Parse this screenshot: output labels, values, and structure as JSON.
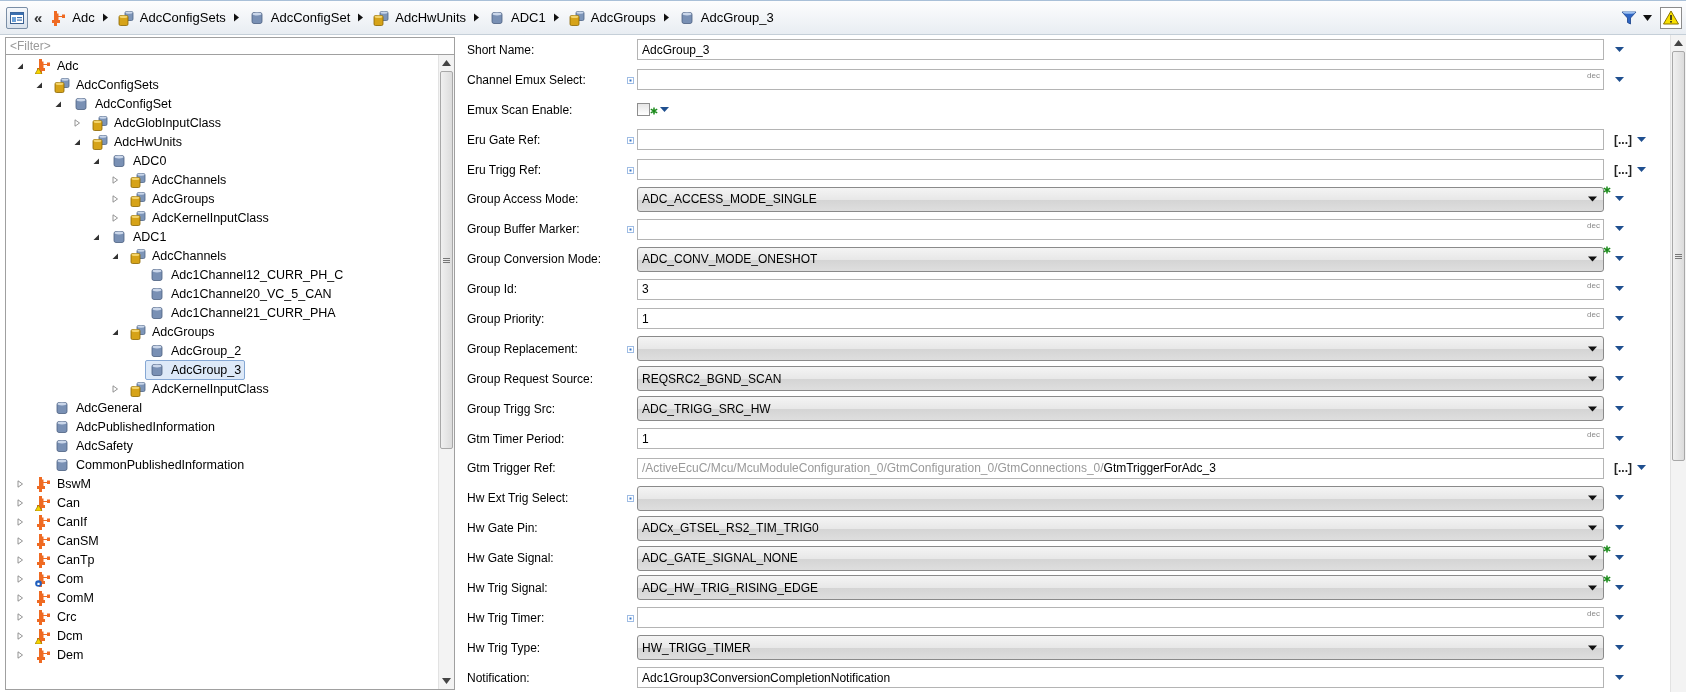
{
  "breadcrumb": {
    "history_glyph": "«",
    "items": [
      {
        "label": "Adc",
        "kind": "module"
      },
      {
        "label": "AdcConfigSets",
        "kind": "container"
      },
      {
        "label": "AdcConfigSet",
        "kind": "item"
      },
      {
        "label": "AdcHwUnits",
        "kind": "container"
      },
      {
        "label": "ADC1",
        "kind": "item"
      },
      {
        "label": "AdcGroups",
        "kind": "container"
      },
      {
        "label": "AdcGroup_3",
        "kind": "item"
      }
    ]
  },
  "tree": {
    "filter": {
      "placeholder": "<Filter>"
    },
    "items": [
      {
        "label": "Adc",
        "kind": "module",
        "warning": true,
        "locked": false,
        "expanded": true,
        "selected": false,
        "children": [
          {
            "label": "AdcConfigSets",
            "kind": "container",
            "expanded": true,
            "selected": false,
            "children": [
              {
                "label": "AdcConfigSet",
                "kind": "item",
                "expanded": true,
                "selected": false,
                "children": [
                  {
                    "label": "AdcGlobInputClass",
                    "kind": "container",
                    "expanded": false,
                    "selected": false
                  },
                  {
                    "label": "AdcHwUnits",
                    "kind": "container",
                    "expanded": true,
                    "selected": false,
                    "children": [
                      {
                        "label": "ADC0",
                        "kind": "item",
                        "expanded": true,
                        "selected": false,
                        "children": [
                          {
                            "label": "AdcChannels",
                            "kind": "container",
                            "expanded": false,
                            "selected": false
                          },
                          {
                            "label": "AdcGroups",
                            "kind": "container",
                            "expanded": false,
                            "selected": false
                          },
                          {
                            "label": "AdcKernelInputClass",
                            "kind": "container",
                            "expanded": false,
                            "selected": false
                          }
                        ]
                      },
                      {
                        "label": "ADC1",
                        "kind": "item",
                        "expanded": true,
                        "selected": false,
                        "children": [
                          {
                            "label": "AdcChannels",
                            "kind": "container",
                            "expanded": true,
                            "selected": false,
                            "children": [
                              {
                                "label": "Adc1Channel12_CURR_PH_C",
                                "kind": "item",
                                "selected": false
                              },
                              {
                                "label": "Adc1Channel20_VC_5_CAN",
                                "kind": "item",
                                "selected": false
                              },
                              {
                                "label": "Adc1Channel21_CURR_PHA",
                                "kind": "item",
                                "selected": false
                              }
                            ]
                          },
                          {
                            "label": "AdcGroups",
                            "kind": "container",
                            "expanded": true,
                            "selected": false,
                            "children": [
                              {
                                "label": "AdcGroup_2",
                                "kind": "item",
                                "selected": false
                              },
                              {
                                "label": "AdcGroup_3",
                                "kind": "item",
                                "selected": true
                              }
                            ]
                          },
                          {
                            "label": "AdcKernelInputClass",
                            "kind": "container",
                            "expanded": false,
                            "selected": false
                          }
                        ]
                      }
                    ]
                  }
                ]
              }
            ]
          },
          {
            "label": "AdcGeneral",
            "kind": "item",
            "selected": false
          },
          {
            "label": "AdcPublishedInformation",
            "kind": "item",
            "selected": false
          },
          {
            "label": "AdcSafety",
            "kind": "item",
            "selected": false
          },
          {
            "label": "CommonPublishedInformation",
            "kind": "item",
            "selected": false
          }
        ]
      },
      {
        "label": "BswM",
        "kind": "module",
        "warning": false,
        "locked": false,
        "expanded": false,
        "selected": false
      },
      {
        "label": "Can",
        "kind": "module",
        "warning": true,
        "locked": false,
        "expanded": false,
        "selected": false
      },
      {
        "label": "CanIf",
        "kind": "module",
        "warning": false,
        "locked": false,
        "expanded": false,
        "selected": false
      },
      {
        "label": "CanSM",
        "kind": "module",
        "warning": false,
        "locked": false,
        "expanded": false,
        "selected": false
      },
      {
        "label": "CanTp",
        "kind": "module",
        "warning": false,
        "locked": false,
        "expanded": false,
        "selected": false
      },
      {
        "label": "Com",
        "kind": "module",
        "warning": false,
        "locked": true,
        "expanded": false,
        "selected": false
      },
      {
        "label": "ComM",
        "kind": "module",
        "warning": false,
        "locked": false,
        "expanded": false,
        "selected": false
      },
      {
        "label": "Crc",
        "kind": "module",
        "warning": false,
        "locked": false,
        "expanded": false,
        "selected": false
      },
      {
        "label": "Dcm",
        "kind": "module",
        "warning": true,
        "locked": false,
        "expanded": false,
        "selected": false
      },
      {
        "label": "Dem",
        "kind": "module",
        "warning": false,
        "locked": false,
        "expanded": false,
        "selected": false
      }
    ]
  },
  "form": {
    "fields": [
      {
        "label": "Short Name:",
        "kind": "text",
        "value": "AdcGroup_3",
        "annotated": false,
        "modified": false
      },
      {
        "label": "Channel Emux Select:",
        "kind": "text",
        "unit": "dec",
        "annotated": true,
        "modified": false
      },
      {
        "label": "Emux Scan Enable:",
        "kind": "checkbox",
        "checked": false,
        "annotated": false,
        "modified": true
      },
      {
        "label": "Eru Gate Ref:",
        "kind": "reference",
        "browse_label": "[...]",
        "annotated": true,
        "modified": false
      },
      {
        "label": "Eru Trigg Ref:",
        "kind": "reference",
        "browse_label": "[...]",
        "annotated": true,
        "modified": false
      },
      {
        "label": "Group Access Mode:",
        "kind": "select",
        "value": "ADC_ACCESS_MODE_SINGLE",
        "annotated": false,
        "modified": true
      },
      {
        "label": "Group Buffer Marker:",
        "kind": "text",
        "unit": "dec",
        "annotated": true,
        "modified": false
      },
      {
        "label": "Group Conversion Mode:",
        "kind": "select",
        "value": "ADC_CONV_MODE_ONESHOT",
        "annotated": false,
        "modified": true
      },
      {
        "label": "Group Id:",
        "kind": "text",
        "value": "3",
        "unit": "dec",
        "annotated": false,
        "modified": false
      },
      {
        "label": "Group Priority:",
        "kind": "text",
        "value": "1",
        "unit": "dec",
        "annotated": false,
        "modified": false
      },
      {
        "label": "Group Replacement:",
        "kind": "select",
        "annotated": true,
        "modified": false
      },
      {
        "label": "Group Request Source:",
        "kind": "select",
        "value": "REQSRC2_BGND_SCAN",
        "annotated": false,
        "modified": false
      },
      {
        "label": "Group Trigg Src:",
        "kind": "select",
        "value": "ADC_TRIGG_SRC_HW",
        "annotated": false,
        "modified": false
      },
      {
        "label": "Gtm Timer Period:",
        "kind": "text",
        "value": "1",
        "unit": "dec",
        "annotated": false,
        "modified": false
      },
      {
        "label": "Gtm Trigger Ref:",
        "kind": "reference",
        "prefix": "/ActiveEcuC/Mcu/McuModuleConfiguration_0/GtmConfiguration_0/GtmConnections_0/",
        "value": "GtmTriggerForAdc_3",
        "browse_label": "[...]",
        "annotated": false,
        "modified": false
      },
      {
        "label": "Hw Ext Trig Select:",
        "kind": "select",
        "annotated": true,
        "modified": false
      },
      {
        "label": "Hw Gate Pin:",
        "kind": "select",
        "value": "ADCx_GTSEL_RS2_TIM_TRIG0",
        "annotated": false,
        "modified": false
      },
      {
        "label": "Hw Gate Signal:",
        "kind": "select",
        "value": "ADC_GATE_SIGNAL_NONE",
        "annotated": false,
        "modified": true
      },
      {
        "label": "Hw Trig Signal:",
        "kind": "select",
        "value": "ADC_HW_TRIG_RISING_EDGE",
        "annotated": false,
        "modified": true
      },
      {
        "label": "Hw Trig Timer:",
        "kind": "text",
        "unit": "dec",
        "annotated": true,
        "modified": false
      },
      {
        "label": "Hw Trig Type:",
        "kind": "select",
        "value": "HW_TRIGG_TIMER",
        "annotated": false,
        "modified": false
      },
      {
        "label": "Notification:",
        "kind": "text",
        "value": "Adc1Group3ConversionCompletionNotification",
        "annotated": false,
        "modified": false
      }
    ]
  }
}
